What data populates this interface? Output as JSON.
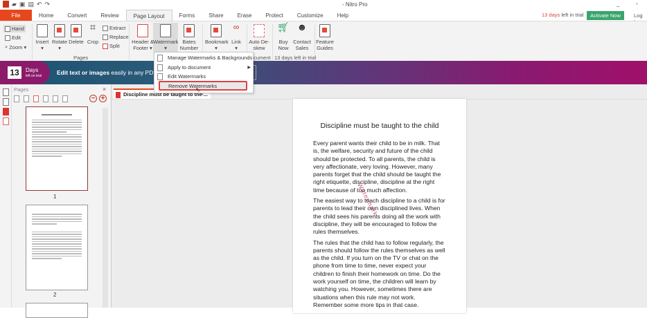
{
  "window": {
    "title": "- Nitro Pro",
    "minimize": "_",
    "restore": "▫"
  },
  "tabs": [
    "File",
    "Home",
    "Convert",
    "Review",
    "Page Layout",
    "Forms",
    "Share",
    "Erase",
    "Protect",
    "Customize",
    "Help"
  ],
  "trial": {
    "days": "13 days",
    "rest": " left in trial",
    "activate": "Activate Now",
    "login": "Log In"
  },
  "ribbon": {
    "hand": "Hand",
    "edit": "Edit",
    "zoom": "Zoom ▾",
    "insert": "Insert",
    "rotate": "Rotate",
    "delete": "Delete",
    "crop": "Crop",
    "extract": "Extract",
    "replace": "Replace",
    "split": "Split",
    "pages_group": "Pages",
    "header_footer": "Header & Footer ▾",
    "watermark": "Watermark",
    "bates": "Bates Number ▾",
    "bookmark": "Bookmark",
    "link": "Link",
    "auto_deskew": "Auto De-skew",
    "document_group": "cument",
    "buy_now": "Buy Now",
    "contact_sales": "Contact Sales",
    "trial_group": "13 days left in trial",
    "feature_guides": "Feature Guides"
  },
  "watermark_menu": {
    "items": [
      "Manage Watermarks & Backgrounds",
      "Apply to document",
      "Edit Watermarks",
      "Remove Watermarks"
    ]
  },
  "banner": {
    "days": "13",
    "days_label": "Days",
    "days_sub": "left on trial",
    "text_bold": "Edit text or images",
    "text_rest": " easily in any PDF"
  },
  "pages_panel": {
    "title": "Pages",
    "close": "×",
    "page_numbers": [
      "1",
      "2"
    ]
  },
  "document": {
    "tab_title": "Discipline must be taught to the ...",
    "tab_close": "×",
    "title": "Discipline must be taught to the child",
    "watermark_text": "Watermark",
    "paragraphs": [
      "Every parent wants their child to be in milk. That is, the welfare, security and future of the child should be protected. To all parents, the child is very affectionate, very loving. However, many parents forget that the child should be taught the right etiquette, discipline, discipline at the right time because of too much affection.",
      "The easiest way to teach discipline to a child is for parents to lead their own disciplined lives. When the child sees his parents doing all the work with discipline, they will be encouraged to follow the rules themselves.",
      "The rules that the child has to follow regularly, the parents should follow the rules themselves as well as the child. If you turn on the TV or chat on the phone from time to time, never expect your children to finish their homework on time. Do the work yourself on time, the children will learn by watching you. However, sometimes there are situations when this rule may not work. Remember some more tips in that case."
    ]
  }
}
